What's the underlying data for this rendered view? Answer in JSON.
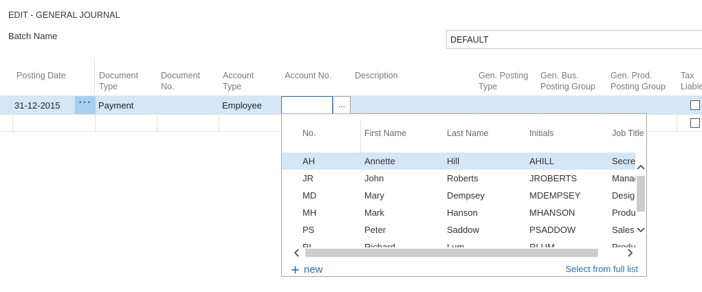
{
  "page": {
    "title": "EDIT - GENERAL JOURNAL"
  },
  "batch": {
    "label": "Batch Name",
    "value": "DEFAULT"
  },
  "grid": {
    "columns": [
      "Posting Date",
      "Document\nType",
      "Document\nNo.",
      "Account\nType",
      "Account No.",
      "Description",
      "Gen. Posting\nType",
      "Gen. Bus.\nPosting Group",
      "Gen. Prod.\nPosting Group",
      "Tax\nLiable"
    ],
    "row1": {
      "posting_date": "31-12-2015",
      "actions": "···",
      "document_type": "Payment",
      "account_type": "Employee",
      "account_no": "",
      "lookup": "..."
    }
  },
  "lookup": {
    "columns": [
      "No.",
      "First Name",
      "Last Name",
      "Initials",
      "Job Title"
    ],
    "rows": [
      [
        "AH",
        "Annette",
        "Hill",
        "AHILL",
        "Secretary"
      ],
      [
        "JR",
        "John",
        "Roberts",
        "JROBERTS",
        "Manager"
      ],
      [
        "MD",
        "Mary",
        "Dempsey",
        "MDEMPSEY",
        "Designer"
      ],
      [
        "MH",
        "Mark",
        "Hanson",
        "MHANSON",
        "Production"
      ],
      [
        "PS",
        "Peter",
        "Saddow",
        "PSADDOW",
        "Sales"
      ],
      [
        "RL",
        "Richard",
        "Lum",
        "RLUM",
        "Production"
      ]
    ],
    "selected_index": 0,
    "new_label": "new",
    "full_list_label": "Select from full list"
  },
  "icons": {
    "plus": "plus-icon",
    "chevron_up": "chevron-up-icon",
    "chevron_down": "chevron-down-icon",
    "chevron_left": "chevron-left-icon",
    "chevron_right": "chevron-right-icon"
  },
  "colors": {
    "selected_row": "#d4e7f6",
    "actions_cell": "#a9cfee",
    "accent": "#2f6fae"
  }
}
